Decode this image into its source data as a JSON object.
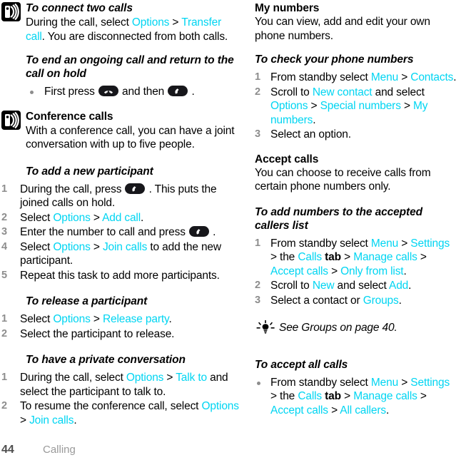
{
  "document": {
    "page_number": "44",
    "chapter": "Calling",
    "accent_color": "#00d5f2",
    "text_color": "#000000"
  },
  "left_column": {
    "topic_connect": {
      "icon": "broadcast-signal-icon",
      "heading": "To connect two calls",
      "body_prefix": "During the call, select ",
      "link_options": "Options",
      "sep": " > ",
      "link_transfer": "Transfer call",
      "body_suffix": ". You are disconnected from both calls."
    },
    "task_end_ongoing": {
      "heading": "To end an ongoing call and return to the call on hold",
      "bullet_prefix": "First press ",
      "key_endcall": "end-call-key-icon",
      "bullet_middle": " and then ",
      "key_call": "call-key-icon",
      "bullet_suffix": " ."
    },
    "topic_conference": {
      "icon": "broadcast-signal-icon",
      "heading": "Conference calls",
      "body": "With a conference call, you can have a joint conversation with up to five people."
    },
    "task_add_participant": {
      "heading": "To add a new participant",
      "steps": [
        {
          "num": "1",
          "prefix": "During the call, press ",
          "key": "call-key-icon",
          "suffix": " . This puts the joined calls on hold."
        },
        {
          "num": "2",
          "prefix": "Select ",
          "link1": "Options",
          "sep": " > ",
          "link2": "Add call",
          "suffix": "."
        },
        {
          "num": "3",
          "prefix": "Enter the number to call and press ",
          "key": "call-key-icon",
          "suffix": " ."
        },
        {
          "num": "4",
          "prefix": "Select ",
          "link1": "Options",
          "sep": " > ",
          "link2": "Join calls",
          "suffix": " to add the new participant."
        },
        {
          "num": "5",
          "prefix": "Repeat this task to add more participants.",
          "link1": "",
          "sep": "",
          "link2": "",
          "suffix": ""
        }
      ]
    },
    "task_release_participant": {
      "heading": "To release a participant",
      "steps": [
        {
          "num": "1",
          "prefix": "Select ",
          "link1": "Options",
          "sep": " > ",
          "link2": "Release party",
          "suffix": "."
        },
        {
          "num": "2",
          "prefix": "Select the participant to release.",
          "link1": "",
          "sep": "",
          "link2": "",
          "suffix": ""
        }
      ]
    },
    "task_private_conversation": {
      "heading": "To have a private conversation",
      "step1": {
        "num": "1",
        "prefix": "During the call, select ",
        "link1": "Options",
        "sep": " > ",
        "link2": "Talk to",
        "suffix": " and select the participant to talk to."
      },
      "step2": {
        "num": "2",
        "prefix": "To resume the conference call, select ",
        "link1": "Options",
        "sep": " > ",
        "link2": "Join calls",
        "suffix": "."
      }
    }
  },
  "right_column": {
    "topic_my_numbers": {
      "heading": "My numbers",
      "body": "You can view, add and edit your own phone numbers."
    },
    "task_check_numbers": {
      "heading": "To check your phone numbers",
      "step1": {
        "num": "1",
        "prefix": "From standby select ",
        "link1": "Menu",
        "sep": " > ",
        "link2": "Contacts",
        "suffix": "."
      },
      "step2": {
        "num": "2",
        "prefix": "Scroll to ",
        "link1": "New contact",
        "mid": " and select ",
        "link2": "Options",
        "sep2": " > ",
        "link3": "Special numbers",
        "sep3": " > ",
        "link4": "My numbers",
        "suffix": "."
      },
      "step3": {
        "num": "3",
        "text": "Select an option."
      }
    },
    "topic_accept_calls": {
      "heading": "Accept calls",
      "body": "You can choose to receive calls from certain phone numbers only."
    },
    "task_add_accepted": {
      "heading": "To add numbers to the accepted callers list",
      "step1": {
        "num": "1",
        "prefix": "From standby select ",
        "link1": "Menu",
        "sep1": " > ",
        "link2": "Settings",
        "mid1": " > the ",
        "link3": "Calls",
        "mid2": " tab",
        "sep2": " > ",
        "link4": "Manage calls",
        "sep3": " > ",
        "link5": "Accept calls",
        "sep4": " > ",
        "link6": "Only from list",
        "suffix": "."
      },
      "step2": {
        "num": "2",
        "prefix": "Scroll to ",
        "link1": "New",
        "mid": " and select ",
        "link2": "Add",
        "suffix": "."
      },
      "step3": {
        "num": "3",
        "prefix": "Select a contact or ",
        "link1": "Groups",
        "suffix": "."
      }
    },
    "tip": {
      "icon": "lightbulb-tip-icon",
      "text": "See Groups on page 40."
    },
    "task_accept_all": {
      "heading": "To accept all calls",
      "bullet": {
        "prefix": "From standby select ",
        "link1": "Menu",
        "sep1": " > ",
        "link2": "Settings",
        "mid1": " > the ",
        "link3": "Calls",
        "mid2": " tab",
        "sep2": " > ",
        "link4": "Manage calls",
        "sep3": " > ",
        "link5": "Accept calls",
        "sep4": " > ",
        "link6": "All callers",
        "suffix": "."
      }
    }
  }
}
